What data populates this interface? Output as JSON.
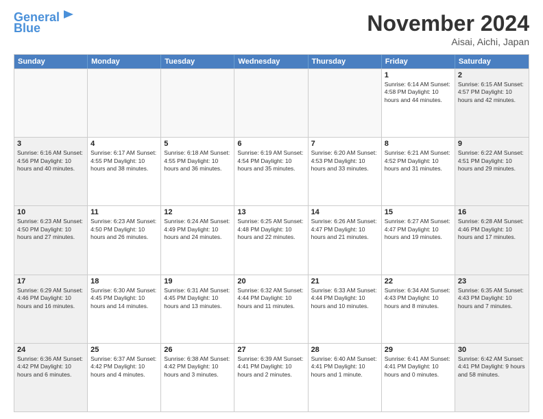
{
  "header": {
    "logo_line1": "General",
    "logo_line2": "Blue",
    "month": "November 2024",
    "location": "Aisai, Aichi, Japan"
  },
  "weekdays": [
    "Sunday",
    "Monday",
    "Tuesday",
    "Wednesday",
    "Thursday",
    "Friday",
    "Saturday"
  ],
  "rows": [
    [
      {
        "day": "",
        "info": ""
      },
      {
        "day": "",
        "info": ""
      },
      {
        "day": "",
        "info": ""
      },
      {
        "day": "",
        "info": ""
      },
      {
        "day": "",
        "info": ""
      },
      {
        "day": "1",
        "info": "Sunrise: 6:14 AM\nSunset: 4:58 PM\nDaylight: 10 hours\nand 44 minutes."
      },
      {
        "day": "2",
        "info": "Sunrise: 6:15 AM\nSunset: 4:57 PM\nDaylight: 10 hours\nand 42 minutes."
      }
    ],
    [
      {
        "day": "3",
        "info": "Sunrise: 6:16 AM\nSunset: 4:56 PM\nDaylight: 10 hours\nand 40 minutes."
      },
      {
        "day": "4",
        "info": "Sunrise: 6:17 AM\nSunset: 4:55 PM\nDaylight: 10 hours\nand 38 minutes."
      },
      {
        "day": "5",
        "info": "Sunrise: 6:18 AM\nSunset: 4:55 PM\nDaylight: 10 hours\nand 36 minutes."
      },
      {
        "day": "6",
        "info": "Sunrise: 6:19 AM\nSunset: 4:54 PM\nDaylight: 10 hours\nand 35 minutes."
      },
      {
        "day": "7",
        "info": "Sunrise: 6:20 AM\nSunset: 4:53 PM\nDaylight: 10 hours\nand 33 minutes."
      },
      {
        "day": "8",
        "info": "Sunrise: 6:21 AM\nSunset: 4:52 PM\nDaylight: 10 hours\nand 31 minutes."
      },
      {
        "day": "9",
        "info": "Sunrise: 6:22 AM\nSunset: 4:51 PM\nDaylight: 10 hours\nand 29 minutes."
      }
    ],
    [
      {
        "day": "10",
        "info": "Sunrise: 6:23 AM\nSunset: 4:50 PM\nDaylight: 10 hours\nand 27 minutes."
      },
      {
        "day": "11",
        "info": "Sunrise: 6:23 AM\nSunset: 4:50 PM\nDaylight: 10 hours\nand 26 minutes."
      },
      {
        "day": "12",
        "info": "Sunrise: 6:24 AM\nSunset: 4:49 PM\nDaylight: 10 hours\nand 24 minutes."
      },
      {
        "day": "13",
        "info": "Sunrise: 6:25 AM\nSunset: 4:48 PM\nDaylight: 10 hours\nand 22 minutes."
      },
      {
        "day": "14",
        "info": "Sunrise: 6:26 AM\nSunset: 4:47 PM\nDaylight: 10 hours\nand 21 minutes."
      },
      {
        "day": "15",
        "info": "Sunrise: 6:27 AM\nSunset: 4:47 PM\nDaylight: 10 hours\nand 19 minutes."
      },
      {
        "day": "16",
        "info": "Sunrise: 6:28 AM\nSunset: 4:46 PM\nDaylight: 10 hours\nand 17 minutes."
      }
    ],
    [
      {
        "day": "17",
        "info": "Sunrise: 6:29 AM\nSunset: 4:46 PM\nDaylight: 10 hours\nand 16 minutes."
      },
      {
        "day": "18",
        "info": "Sunrise: 6:30 AM\nSunset: 4:45 PM\nDaylight: 10 hours\nand 14 minutes."
      },
      {
        "day": "19",
        "info": "Sunrise: 6:31 AM\nSunset: 4:45 PM\nDaylight: 10 hours\nand 13 minutes."
      },
      {
        "day": "20",
        "info": "Sunrise: 6:32 AM\nSunset: 4:44 PM\nDaylight: 10 hours\nand 11 minutes."
      },
      {
        "day": "21",
        "info": "Sunrise: 6:33 AM\nSunset: 4:44 PM\nDaylight: 10 hours\nand 10 minutes."
      },
      {
        "day": "22",
        "info": "Sunrise: 6:34 AM\nSunset: 4:43 PM\nDaylight: 10 hours\nand 8 minutes."
      },
      {
        "day": "23",
        "info": "Sunrise: 6:35 AM\nSunset: 4:43 PM\nDaylight: 10 hours\nand 7 minutes."
      }
    ],
    [
      {
        "day": "24",
        "info": "Sunrise: 6:36 AM\nSunset: 4:42 PM\nDaylight: 10 hours\nand 6 minutes."
      },
      {
        "day": "25",
        "info": "Sunrise: 6:37 AM\nSunset: 4:42 PM\nDaylight: 10 hours\nand 4 minutes."
      },
      {
        "day": "26",
        "info": "Sunrise: 6:38 AM\nSunset: 4:42 PM\nDaylight: 10 hours\nand 3 minutes."
      },
      {
        "day": "27",
        "info": "Sunrise: 6:39 AM\nSunset: 4:41 PM\nDaylight: 10 hours\nand 2 minutes."
      },
      {
        "day": "28",
        "info": "Sunrise: 6:40 AM\nSunset: 4:41 PM\nDaylight: 10 hours\nand 1 minute."
      },
      {
        "day": "29",
        "info": "Sunrise: 6:41 AM\nSunset: 4:41 PM\nDaylight: 10 hours\nand 0 minutes."
      },
      {
        "day": "30",
        "info": "Sunrise: 6:42 AM\nSunset: 4:41 PM\nDaylight: 9 hours\nand 58 minutes."
      }
    ]
  ]
}
